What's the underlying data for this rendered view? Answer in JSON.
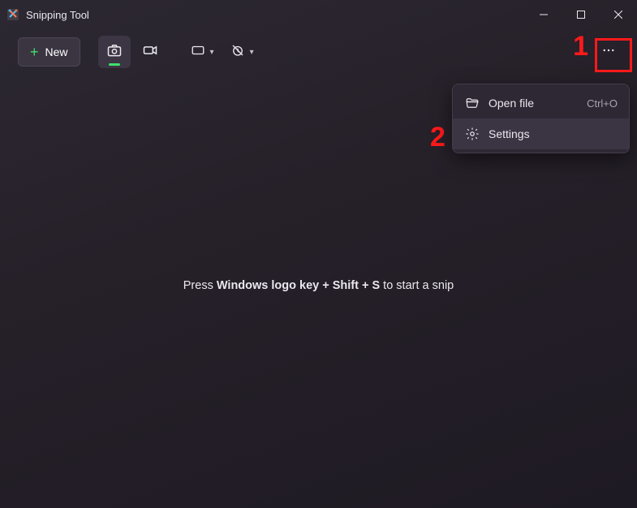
{
  "titlebar": {
    "title": "Snipping Tool"
  },
  "toolbar": {
    "new_label": "New",
    "icons": {
      "camera": "camera-icon",
      "video": "video-icon",
      "shape": "rect-mode-icon",
      "delay": "no-delay-icon"
    }
  },
  "menu": {
    "items": [
      {
        "icon": "folder-open-icon",
        "label": "Open file",
        "accel": "Ctrl+O"
      },
      {
        "icon": "gear-icon",
        "label": "Settings",
        "accel": ""
      }
    ]
  },
  "body": {
    "prefix": "Press ",
    "shortcut": "Windows logo key + Shift + S",
    "suffix": " to start a snip"
  },
  "annotations": {
    "n1": "1",
    "n2": "2"
  }
}
